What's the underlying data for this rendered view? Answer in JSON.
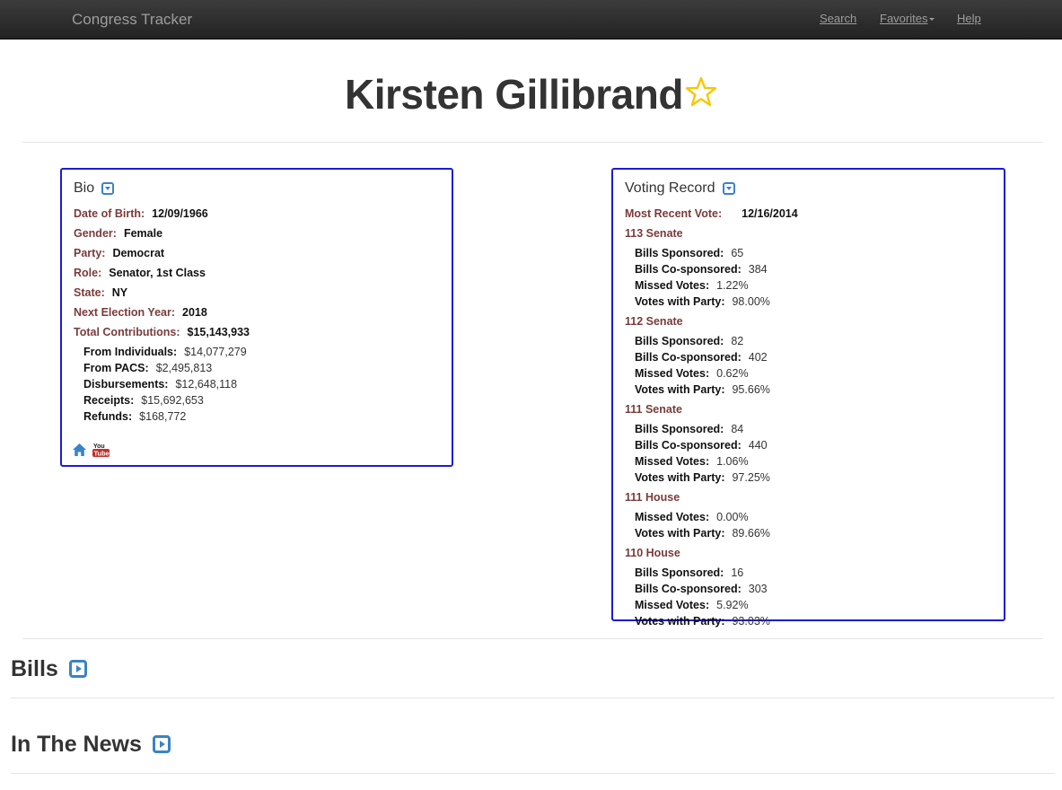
{
  "navbar": {
    "brand": "Congress Tracker",
    "links": {
      "search": "Search",
      "favorites": "Favorites",
      "help": "Help"
    }
  },
  "page": {
    "title": "Kirsten Gillibrand",
    "star_icon": "star-outline-icon",
    "star_color": "#f5c800"
  },
  "bio": {
    "heading": "Bio",
    "fields": [
      {
        "label": "Date of Birth:",
        "value": "12/09/1966"
      },
      {
        "label": "Gender:",
        "value": "Female"
      },
      {
        "label": "Party:",
        "value": "Democrat"
      },
      {
        "label": "Role:",
        "value": "Senator, 1st Class"
      },
      {
        "label": "State:",
        "value": "NY"
      },
      {
        "label": "Next Election Year:",
        "value": "2018"
      },
      {
        "label": "Total Contributions:",
        "value": "$15,143,933"
      }
    ],
    "contributions": [
      {
        "label": "From Individuals:",
        "value": "$14,077,279"
      },
      {
        "label": "From PACS:",
        "value": "$2,495,813"
      },
      {
        "label": "Disbursements:",
        "value": "$12,648,118"
      },
      {
        "label": "Receipts:",
        "value": "$15,692,653"
      },
      {
        "label": "Refunds:",
        "value": "$168,772"
      }
    ],
    "youtube_top": "You",
    "youtube_bottom": "Tube"
  },
  "voting": {
    "heading": "Voting Record",
    "most_recent_label": "Most Recent Vote:",
    "most_recent_value": "12/16/2014",
    "sections": [
      {
        "title": "113 Senate",
        "rows": [
          {
            "label": "Bills Sponsored:",
            "value": "65"
          },
          {
            "label": "Bills Co-sponsored:",
            "value": "384"
          },
          {
            "label": "Missed Votes:",
            "value": "1.22%"
          },
          {
            "label": "Votes with Party:",
            "value": "98.00%"
          }
        ]
      },
      {
        "title": "112 Senate",
        "rows": [
          {
            "label": "Bills Sponsored:",
            "value": "82"
          },
          {
            "label": "Bills Co-sponsored:",
            "value": "402"
          },
          {
            "label": "Missed Votes:",
            "value": "0.62%"
          },
          {
            "label": "Votes with Party:",
            "value": "95.66%"
          }
        ]
      },
      {
        "title": "111 Senate",
        "rows": [
          {
            "label": "Bills Sponsored:",
            "value": "84"
          },
          {
            "label": "Bills Co-sponsored:",
            "value": "440"
          },
          {
            "label": "Missed Votes:",
            "value": "1.06%"
          },
          {
            "label": "Votes with Party:",
            "value": "97.25%"
          }
        ]
      },
      {
        "title": "111 House",
        "rows": [
          {
            "label": "Missed Votes:",
            "value": "0.00%"
          },
          {
            "label": "Votes with Party:",
            "value": "89.66%"
          }
        ]
      },
      {
        "title": "110 House",
        "rows": [
          {
            "label": "Bills Sponsored:",
            "value": "16"
          },
          {
            "label": "Bills Co-sponsored:",
            "value": "303"
          },
          {
            "label": "Missed Votes:",
            "value": "5.92%"
          },
          {
            "label": "Votes with Party:",
            "value": "93.03%"
          }
        ]
      }
    ]
  },
  "sections": {
    "bills": "Bills",
    "news": "In The News"
  }
}
